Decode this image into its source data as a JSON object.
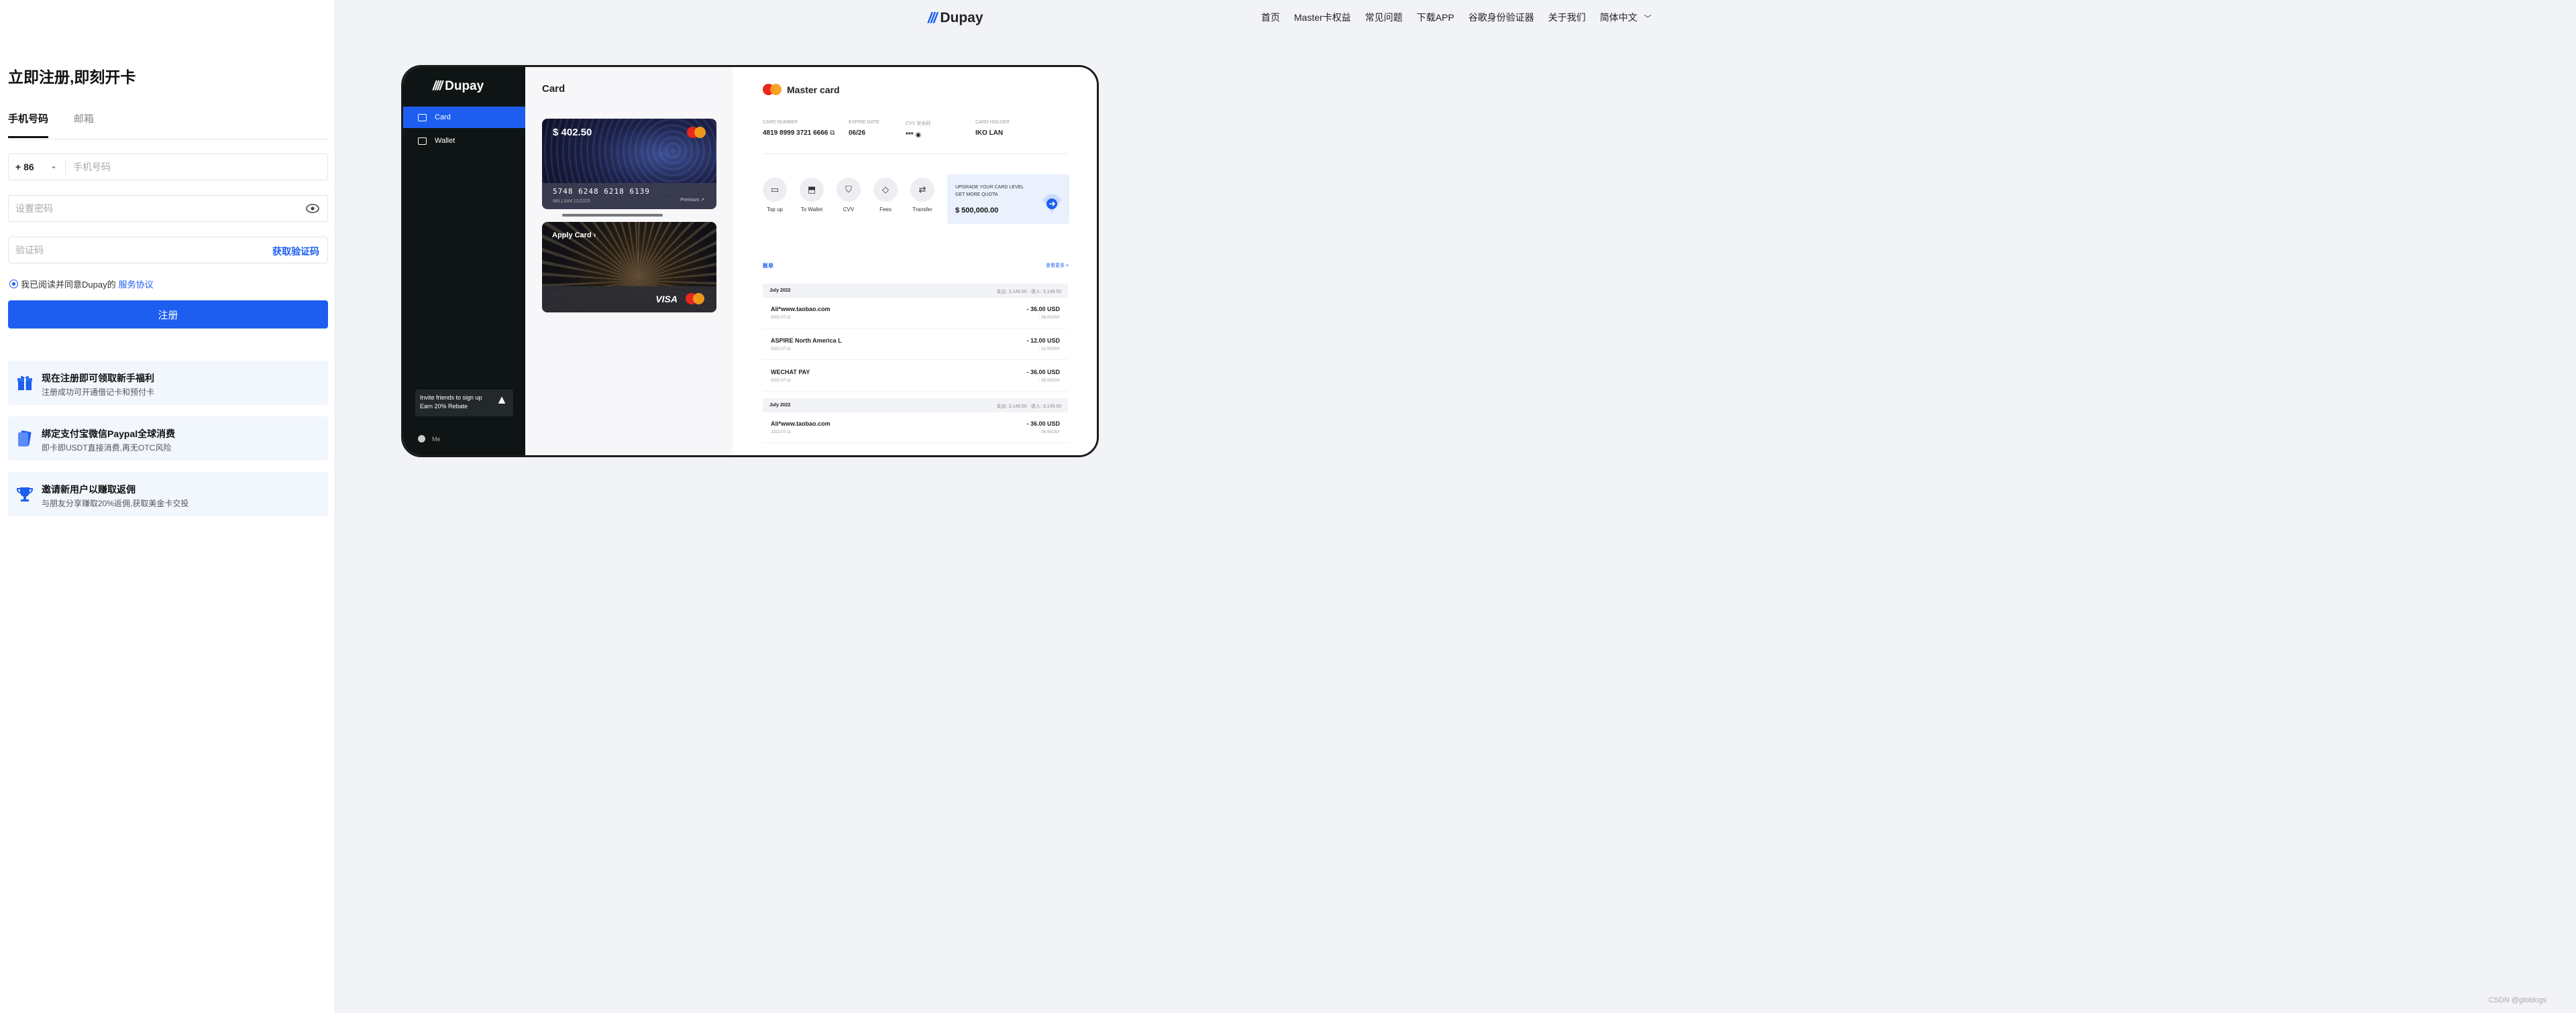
{
  "header": {
    "logo_mark": "///",
    "logo_text": "Dupay",
    "nav": [
      "首页",
      "Master卡权益",
      "常见问题",
      "下载APP",
      "谷歌身份验证器",
      "关于我们",
      "简体中文"
    ],
    "nav_chevron": "chevron-down-icon"
  },
  "register": {
    "title": "立即注册,即刻开卡",
    "tabs": [
      "手机号码",
      "邮箱"
    ],
    "country_code": "+ 86",
    "phone_placeholder": "手机号码",
    "password_placeholder": "设置密码",
    "code_placeholder": "验证码",
    "get_code": "获取验证码",
    "agree_text": "我已阅读并同意Dupay的",
    "agree_link": "服务协议",
    "submit": "注册"
  },
  "promos": [
    {
      "icon": "gift-icon",
      "title": "现在注册即可领取新手福利",
      "sub": "注册成功可开通借记卡和预付卡"
    },
    {
      "icon": "card-bind-icon",
      "title": "绑定支付宝微信Paypal全球消费",
      "sub": "即卡即USDT直接消费,再无OTC风险"
    },
    {
      "icon": "trophy-icon",
      "title": "邀请新用户以赚取返佣",
      "sub": "与朋友分享赚取20%返佣,获取美金卡交投"
    }
  ],
  "mockup": {
    "sidebar": {
      "logo_mark": "////",
      "logo_text": "Dupay",
      "items": [
        "Card",
        "Wallet"
      ],
      "invite_line1": "Invite friends to sign up",
      "invite_line2": "Earn 20% Rebate",
      "me": "Me"
    },
    "cards": {
      "title": "Card",
      "balance": "$ 402.50",
      "number": "5748 6248 6218 6139",
      "sub": "WILLIAM   12/2025",
      "tier": "Premium ↗",
      "apply": "Apply Card ›",
      "visa": "VISA"
    },
    "detail": {
      "title": "Master card",
      "info": [
        {
          "label": "CARD NUMBER",
          "value": "4819 8999 3721 6666"
        },
        {
          "label": "EXPIRE DATE",
          "value": "06/26"
        },
        {
          "label": "CVV 安全码",
          "value": "***"
        },
        {
          "label": "CARD HOLDER",
          "value": "IKO LAN"
        }
      ],
      "actions": [
        {
          "label": "Top up",
          "icon": "topup-icon"
        },
        {
          "label": "To Wallet",
          "icon": "to-wallet-icon"
        },
        {
          "label": "CVV",
          "icon": "shield-icon"
        },
        {
          "label": "Fees",
          "icon": "diamond-icon"
        },
        {
          "label": "Transfer",
          "icon": "transfer-icon"
        }
      ],
      "upgrade_line1": "UPGRADE YOUR CARD LEVEL",
      "upgrade_line2": "GET MORE QUOTA",
      "upgrade_amount": "$ 500,000.00",
      "bill_title": "账单",
      "bill_more": "查看更多 >",
      "months": [
        {
          "label": "July 2022",
          "summary": "支出: 3,149.50 · 收入: 3,149.50"
        },
        {
          "label": "July 2022",
          "summary": "支出: 3,149.50 · 收入: 3,149.50"
        }
      ],
      "transactions": [
        {
          "name": "Ali*www.taobao.com",
          "date": "2022-07-11",
          "amount": "- 36.00 USD",
          "sub": "- 36.00CNY"
        },
        {
          "name": "ASPIRE North America L",
          "date": "2022-07-11",
          "amount": "- 12.00 USD",
          "sub": "- 12.00CNY"
        },
        {
          "name": "WECHAT PAY",
          "date": "2022-07-11",
          "amount": "- 36.00 USD",
          "sub": "- 36.00CNY"
        },
        {
          "name": "Ali*www.taobao.com",
          "date": "2022-07-11",
          "amount": "- 36.00 USD",
          "sub": "- 36.00CNY"
        }
      ]
    }
  },
  "watermark": "CSDN @globlogs",
  "colors": {
    "accent": "#1d5ef0",
    "sidebar_dark": "#0e1514",
    "promo_bg": "#f2f6fd"
  }
}
